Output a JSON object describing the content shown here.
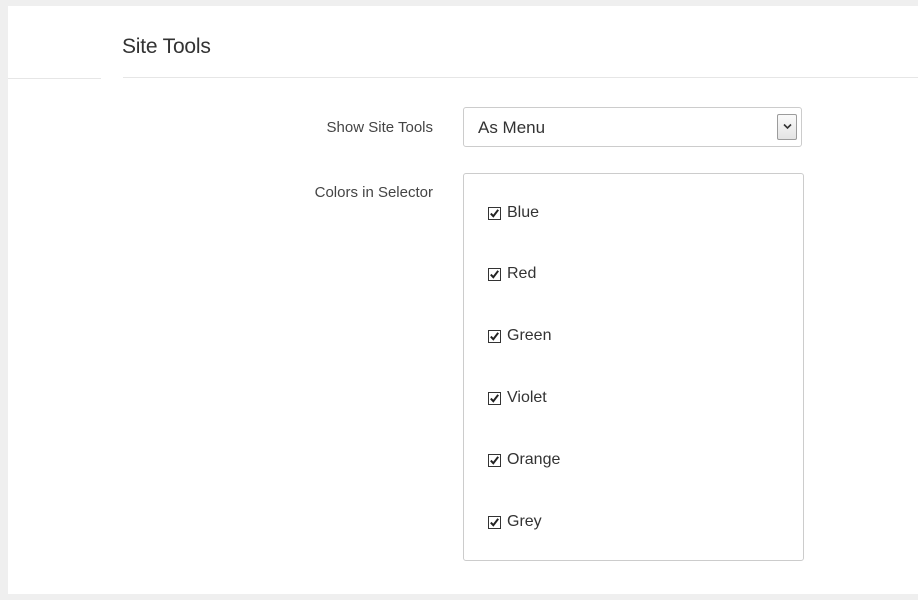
{
  "section": {
    "title": "Site Tools"
  },
  "fields": {
    "show_site_tools": {
      "label": "Show Site Tools",
      "selected_value": "As Menu"
    },
    "colors_in_selector": {
      "label": "Colors in Selector",
      "options": [
        {
          "label": "Blue",
          "checked": true
        },
        {
          "label": "Red",
          "checked": true
        },
        {
          "label": "Green",
          "checked": true
        },
        {
          "label": "Violet",
          "checked": true
        },
        {
          "label": "Orange",
          "checked": true
        },
        {
          "label": "Grey",
          "checked": true
        }
      ]
    }
  },
  "icons": {
    "dropdown": "chevron-down-icon",
    "checkmark": "checkmark-icon"
  },
  "colors": {
    "text": "#333333",
    "border": "#cccccc",
    "background": "#efefef",
    "panel": "#ffffff"
  }
}
